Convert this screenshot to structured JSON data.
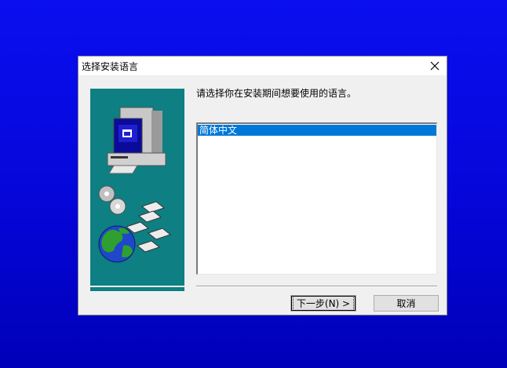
{
  "dialog": {
    "title": "选择安装语言",
    "prompt": "请选择你在安装期间想要使用的语言。",
    "languages": [
      {
        "label": "简体中文",
        "selected": true
      }
    ],
    "buttons": {
      "next": "下一步(N) >",
      "cancel": "取消"
    },
    "icons": {
      "close": "close-icon",
      "illustration": "setup-wizard-illustration"
    },
    "colors": {
      "desktop": "#0000d8",
      "sidebar": "#0e7f82",
      "selection": "#0078d7"
    }
  }
}
